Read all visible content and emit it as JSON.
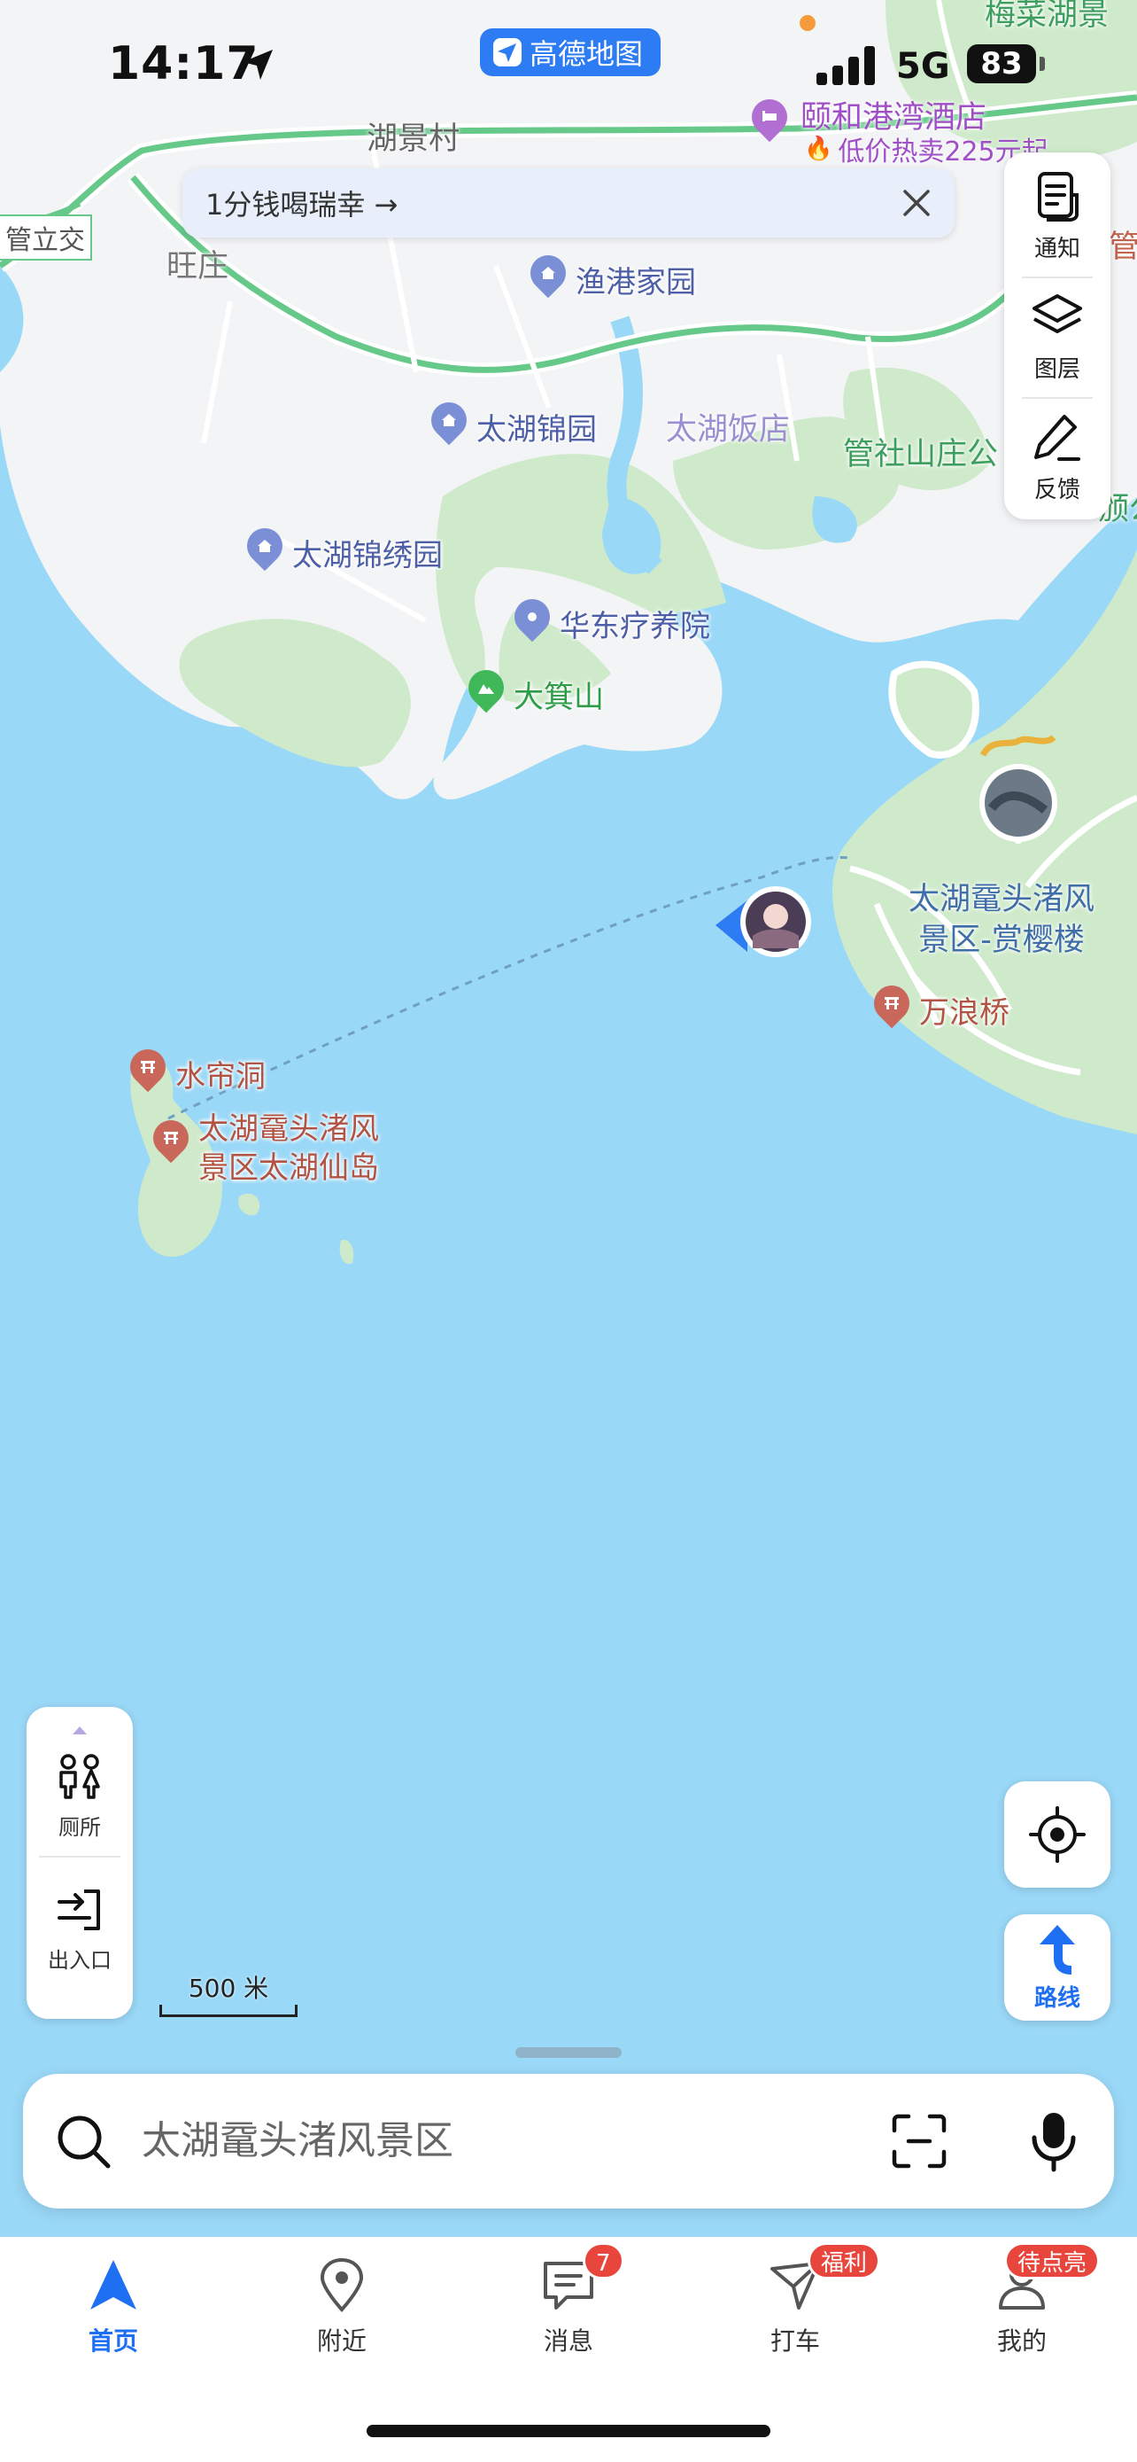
{
  "status_bar": {
    "time": "14:17",
    "network": "5G",
    "battery": "83"
  },
  "app_pill": {
    "label": "高德地图"
  },
  "promo": {
    "text": "1分钱喝瑞幸 →"
  },
  "tools": [
    {
      "label": "通知",
      "icon": "notice-icon"
    },
    {
      "label": "图层",
      "icon": "layers-icon"
    },
    {
      "label": "反馈",
      "icon": "feedback-icon"
    }
  ],
  "map": {
    "area_labels": {
      "hujing": "湖景村",
      "wangzhuang": "旺庄",
      "guanli": "管立交",
      "meiyuan": "梅菜湖景",
      "guanshe": "管社山庄公",
      "guan_right": "管",
      "jing_right": "颁公"
    },
    "hotel": {
      "name": "颐和港湾酒店",
      "deal": "低价热卖225元起"
    },
    "pois": {
      "yugang": "渔港家园",
      "jinyuan": "太湖锦园",
      "fandian": "太湖饭店",
      "jinxiu": "太湖锦绣园",
      "huadong": "华东疗养院",
      "daji": "大箕山",
      "shuilian": "水帘洞",
      "xiandao": "太湖鼋头渚风\n景区太湖仙岛",
      "shangying": "太湖鼋头渚风\n景区-赏樱楼",
      "wanlang": "万浪桥"
    },
    "scale": "500 米"
  },
  "facilities": [
    {
      "label": "厕所",
      "icon": "toilet-icon"
    },
    {
      "label": "出入口",
      "icon": "entrance-icon"
    }
  ],
  "route_button": {
    "label": "路线"
  },
  "search": {
    "value": "太湖鼋头渚风景区"
  },
  "tabs": [
    {
      "label": "首页",
      "icon": "navigation-arrow-icon",
      "active": true
    },
    {
      "label": "附近",
      "icon": "location-pin-icon"
    },
    {
      "label": "消息",
      "icon": "message-icon",
      "badge": "7"
    },
    {
      "label": "打车",
      "icon": "taxi-icon",
      "badge": "福利"
    },
    {
      "label": "我的",
      "icon": "profile-icon",
      "badge": "待点亮"
    }
  ],
  "colors": {
    "accent": "#1f6ff2",
    "water": "#9ad8f7",
    "land": "#f3f4f6",
    "park": "#cfeacb",
    "badge": "#e8463c"
  }
}
